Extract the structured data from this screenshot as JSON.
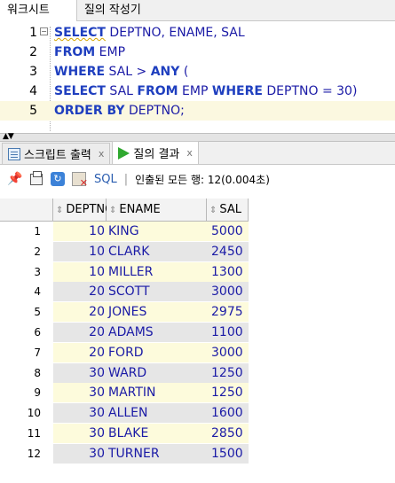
{
  "top_tabs": [
    "워크시트",
    "질의 작성기"
  ],
  "editor": {
    "lines": [
      {
        "no": "1",
        "parts": [
          {
            "t": "SELECT",
            "k": "kw squiggle"
          },
          {
            "t": " DEPTNO, ENAME, SAL",
            "k": "id"
          }
        ]
      },
      {
        "no": "2",
        "parts": [
          {
            "t": "FROM",
            "k": "kw"
          },
          {
            "t": " EMP",
            "k": "id"
          }
        ]
      },
      {
        "no": "3",
        "parts": [
          {
            "t": "WHERE",
            "k": "kw"
          },
          {
            "t": " SAL > ",
            "k": "id"
          },
          {
            "t": "ANY",
            "k": "kw"
          },
          {
            "t": " (",
            "k": "id"
          }
        ]
      },
      {
        "no": "4",
        "parts": [
          {
            "t": "SELECT",
            "k": "kw"
          },
          {
            "t": " SAL ",
            "k": "id"
          },
          {
            "t": "FROM",
            "k": "kw"
          },
          {
            "t": " EMP ",
            "k": "id"
          },
          {
            "t": "WHERE",
            "k": "kw"
          },
          {
            "t": " DEPTNO = 30)",
            "k": "id"
          }
        ]
      },
      {
        "no": "5",
        "parts": [
          {
            "t": "ORDER BY",
            "k": "kw"
          },
          {
            "t": " DEPTNO;",
            "k": "id"
          }
        ]
      }
    ],
    "fold_symbol": "−"
  },
  "bottom_tabs": {
    "script_output": "스크립트 출력",
    "query_result": "질의 결과",
    "close_glyph": "x"
  },
  "toolbar": {
    "sql_label": "SQL",
    "separator": "|",
    "status": "인출된 모든 행: 12(0.004초)"
  },
  "grid": {
    "columns": [
      "DEPTNO",
      "ENAME",
      "SAL"
    ],
    "rows": [
      {
        "n": "1",
        "deptno": "10",
        "ename": "KING",
        "sal": "5000"
      },
      {
        "n": "2",
        "deptno": "10",
        "ename": "CLARK",
        "sal": "2450"
      },
      {
        "n": "3",
        "deptno": "10",
        "ename": "MILLER",
        "sal": "1300"
      },
      {
        "n": "4",
        "deptno": "20",
        "ename": "SCOTT",
        "sal": "3000"
      },
      {
        "n": "5",
        "deptno": "20",
        "ename": "JONES",
        "sal": "2975"
      },
      {
        "n": "6",
        "deptno": "20",
        "ename": "ADAMS",
        "sal": "1100"
      },
      {
        "n": "7",
        "deptno": "20",
        "ename": "FORD",
        "sal": "3000"
      },
      {
        "n": "8",
        "deptno": "30",
        "ename": "WARD",
        "sal": "1250"
      },
      {
        "n": "9",
        "deptno": "30",
        "ename": "MARTIN",
        "sal": "1250"
      },
      {
        "n": "10",
        "deptno": "30",
        "ename": "ALLEN",
        "sal": "1600"
      },
      {
        "n": "11",
        "deptno": "30",
        "ename": "BLAKE",
        "sal": "2850"
      },
      {
        "n": "12",
        "deptno": "30",
        "ename": "TURNER",
        "sal": "1500"
      }
    ]
  },
  "colors": {
    "keyword": "#1f3fbf",
    "identifier": "#1a1aa6",
    "row_odd": "#fdfbdc",
    "row_even": "#e6e6e6"
  }
}
